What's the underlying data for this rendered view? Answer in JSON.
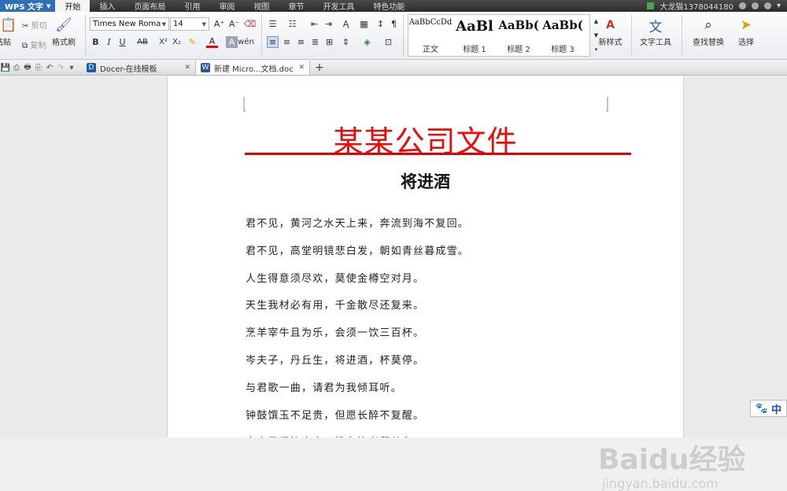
{
  "app": {
    "name": "WPS 文字",
    "user": "大龙猫1378044180"
  },
  "menu": [
    "开始",
    "插入",
    "页面布局",
    "引用",
    "审阅",
    "视图",
    "章节",
    "开发工具",
    "特色功能"
  ],
  "active_menu": "开始",
  "ribbon": {
    "paste": "粘贴",
    "cut": "剪切",
    "copy": "复制",
    "format_painter": "格式刷",
    "font_name": "Times New Roma",
    "font_size": "14",
    "styles": [
      {
        "preview": "AaBbCcDd",
        "name": "正文"
      },
      {
        "preview": "AaBl",
        "name": "标题 1"
      },
      {
        "preview": "AaBb(",
        "name": "标题 2"
      },
      {
        "preview": "AaBb(",
        "name": "标题 3"
      }
    ],
    "new_style": "新样式",
    "text_tools": "文字工具",
    "find_replace": "查找替换",
    "select": "选择"
  },
  "tabs": [
    {
      "label": "Docer-在线模板",
      "active": false
    },
    {
      "label": "新建 Micro...文档.doc *",
      "active": true
    }
  ],
  "document": {
    "heading": "某某公司文件",
    "title": "将进酒",
    "lines": [
      "君不见，黄河之水天上来，奔流到海不复回。",
      "君不见，高堂明镜悲白发，朝如青丝暮成雪。",
      "人生得意须尽欢，莫使金樽空对月。",
      "天生我材必有用，千金散尽还复来。",
      "烹羊宰牛且为乐，会须一饮三百杯。",
      "岑夫子，丹丘生，将进酒，杯莫停。",
      "与君歌一曲，请君为我倾耳听。",
      "钟鼓馔玉不足贵，但愿长醉不复醒。",
      "古来圣贤皆寂寞，惟有饮者留其名。"
    ]
  },
  "watermark": {
    "main": "Baidu经验",
    "sub": "jingyan.baidu.com"
  },
  "ime": {
    "label": "中"
  },
  "colors": {
    "heading": "#ee0a0a",
    "rule": "#e00000",
    "app_button": "#2f6fb8"
  }
}
